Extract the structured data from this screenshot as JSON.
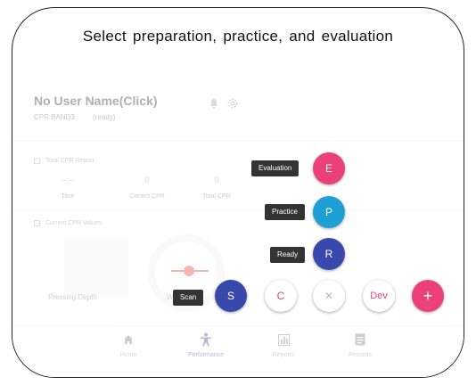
{
  "caption": "Select preparation, practice, and evaluation",
  "user": {
    "name": "No User Name(Click)",
    "device": "CPR BAND3",
    "status": "(ready)"
  },
  "total_report": {
    "title": "Total CPR Report",
    "stats": [
      {
        "value": "--:--",
        "label": "Time"
      },
      {
        "value": "0",
        "label": "Correct CPR"
      },
      {
        "value": "0",
        "label": "Total CPR"
      }
    ]
  },
  "current_values": {
    "title": "Current CPR Values"
  },
  "pressing_depth": "Pressing Depth",
  "w_label": "W",
  "fab_menu": {
    "evaluation": {
      "label": "Evaluation",
      "letter": "E"
    },
    "practice": {
      "label": "Practice",
      "letter": "P"
    },
    "ready": {
      "label": "Ready",
      "letter": "R"
    },
    "scan": {
      "label": "Scan",
      "letter": "S"
    },
    "c": "C",
    "close": "✕",
    "dev": "Dev",
    "plus": "+"
  },
  "nav": [
    {
      "label": "Home"
    },
    {
      "label": "Performance"
    },
    {
      "label": "Reports"
    },
    {
      "label": "Records"
    }
  ],
  "colors": {
    "pink": "#ec407a",
    "blue": "#1ea0d4",
    "indigo": "#3949ab"
  }
}
